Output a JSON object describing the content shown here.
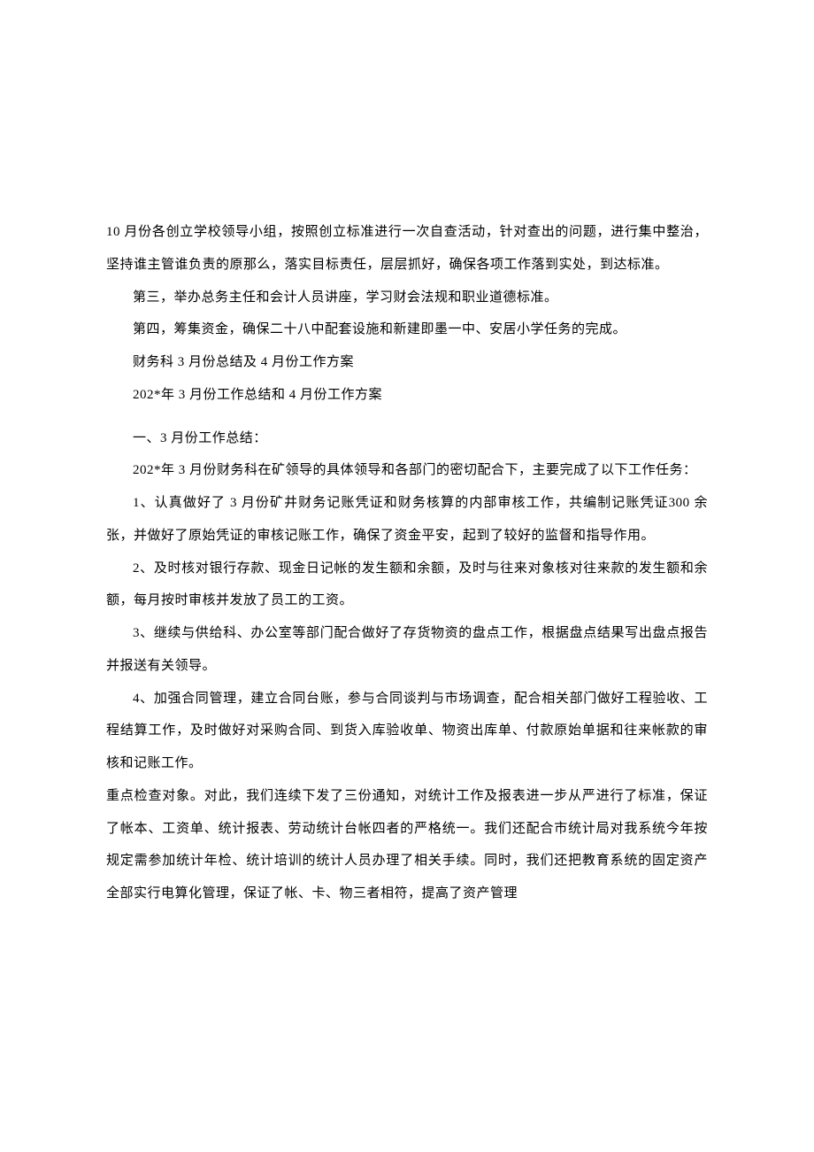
{
  "document": {
    "paragraphs": [
      {
        "text": "10 月份各创立学校领导小组，按照创立标准进行一次自查活动，针对查出的问题，进行集中整治，坚持谁主管谁负责的原那么，落实目标责任，层层抓好，确保各项工作落到实处，到达标准。",
        "indent": false
      },
      {
        "text": "第三，举办总务主任和会计人员讲座，学习财会法规和职业道德标准。",
        "indent": true
      },
      {
        "text": "第四，筹集资金，确保二十八中配套设施和新建即墨一中、安居小学任务的完成。",
        "indent": true
      },
      {
        "text": "财务科 3 月份总结及 4 月份工作方案",
        "indent": true
      },
      {
        "text": "202*年 3 月份工作总结和 4 月份工作方案",
        "indent": true
      },
      {
        "text": "",
        "indent": false,
        "spacer": true
      },
      {
        "text": "一、3 月份工作总结：",
        "indent": true
      },
      {
        "text": "202*年 3 月份财务科在矿领导的具体领导和各部门的密切配合下，主要完成了以下工作任务：",
        "indent": true
      },
      {
        "text": "1、认真做好了 3 月份矿井财务记账凭证和财务核算的内部审核工作，共编制记账凭证300 余张，并做好了原始凭证的审核记账工作，确保了资金平安，起到了较好的监督和指导作用。",
        "indent": true
      },
      {
        "text": "2、及时核对银行存款、现金日记帐的发生额和余额，及时与往来对象核对往来款的发生额和余额，每月按时审核并发放了员工的工资。",
        "indent": true
      },
      {
        "text": "3、继续与供给科、办公室等部门配合做好了存货物资的盘点工作，根据盘点结果写出盘点报告并报送有关领导。",
        "indent": true
      },
      {
        "text": "4、加强合同管理，建立合同台账，参与合同谈判与市场调查，配合相关部门做好工程验收、工程结算工作，及时做好对采购合同、到货入库验收单、物资出库单、付款原始单据和往来帐款的审核和记账工作。",
        "indent": true
      },
      {
        "text": "重点检查对象。对此，我们连续下发了三份通知，对统计工作及报表进一步从严进行了标准，保证了帐本、工资单、统计报表、劳动统计台帐四者的严格统一。我们还配合市统计局对我系统今年按规定需参加统计年检、统计培训的统计人员办理了相关手续。同时，我们还把教育系统的固定资产全部实行电算化管理，保证了帐、卡、物三者相符，提高了资产管理",
        "indent": false
      }
    ]
  }
}
